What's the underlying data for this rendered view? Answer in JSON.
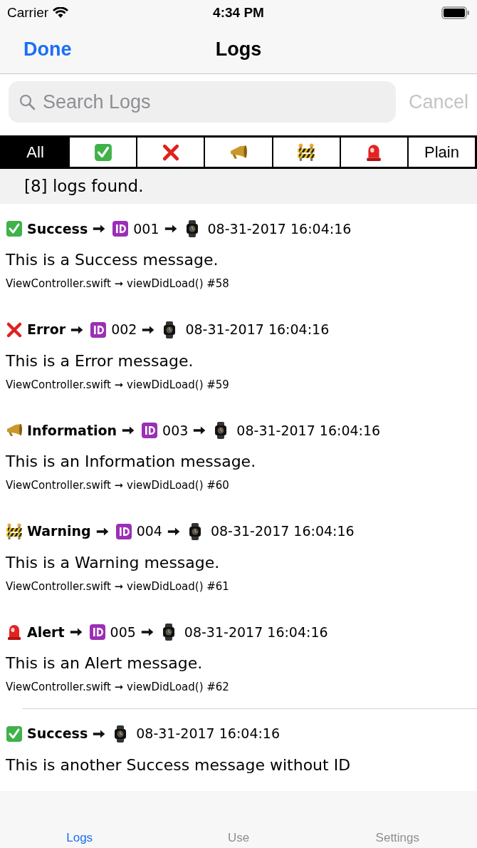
{
  "status_bar": {
    "carrier": "Carrier",
    "time": "4:34 PM"
  },
  "nav": {
    "left_button": "Done",
    "title": "Logs"
  },
  "search": {
    "placeholder": "Search Logs",
    "cancel": "Cancel"
  },
  "filters": [
    {
      "kind": "text",
      "label": "All",
      "selected": true
    },
    {
      "kind": "success",
      "selected": false
    },
    {
      "kind": "error",
      "selected": false
    },
    {
      "kind": "info",
      "selected": false
    },
    {
      "kind": "warning",
      "selected": false
    },
    {
      "kind": "alert",
      "selected": false
    },
    {
      "kind": "text",
      "label": "Plain",
      "selected": false
    }
  ],
  "section_header": "[8] logs found.",
  "logs": [
    {
      "kind": "success",
      "title": "Success",
      "id": "001",
      "timestamp": "08-31-2017 16:04:16",
      "message": "This is a Success message.",
      "source": "ViewController.swift ➞ viewDidLoad() #58",
      "divider_above": false
    },
    {
      "kind": "error",
      "title": "Error",
      "id": "002",
      "timestamp": "08-31-2017 16:04:16",
      "message": "This is a Error message.",
      "source": "ViewController.swift ➞ viewDidLoad() #59",
      "divider_above": false
    },
    {
      "kind": "info",
      "title": "Information",
      "id": "003",
      "timestamp": "08-31-2017 16:04:16",
      "message": "This is an Information message.",
      "source": "ViewController.swift ➞ viewDidLoad() #60",
      "divider_above": false
    },
    {
      "kind": "warning",
      "title": "Warning",
      "id": "004",
      "timestamp": "08-31-2017 16:04:16",
      "message": "This is a Warning message.",
      "source": "ViewController.swift ➞ viewDidLoad() #61",
      "divider_above": false
    },
    {
      "kind": "alert",
      "title": "Alert",
      "id": "005",
      "timestamp": "08-31-2017 16:04:16",
      "message": "This is an Alert message.",
      "source": "ViewController.swift ➞ viewDidLoad() #62",
      "divider_above": false
    },
    {
      "kind": "success",
      "title": "Success",
      "timestamp": "08-31-2017 16:04:16",
      "message": "This is another Success message without ID",
      "divider_above": true
    }
  ],
  "tab_bar": [
    {
      "label": "Logs",
      "selected": true
    },
    {
      "label": "Use",
      "selected": false
    },
    {
      "label": "Settings",
      "selected": false
    }
  ]
}
